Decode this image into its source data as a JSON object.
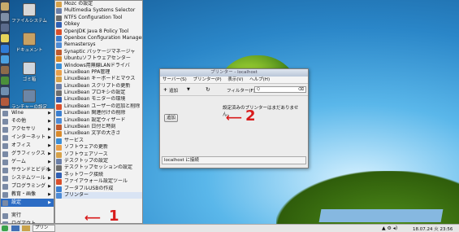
{
  "desktop": {
    "icons": [
      "ファイルシステム",
      "ドキュメント",
      "ゴミ箱",
      "ランチャーの設定"
    ]
  },
  "main_menu": {
    "items": [
      {
        "label": "Wine",
        "sub": true
      },
      {
        "label": "その他",
        "sub": true
      },
      {
        "label": "アクセサリ",
        "sub": true
      },
      {
        "label": "インターネット",
        "sub": true
      },
      {
        "label": "オフィス",
        "sub": true
      },
      {
        "label": "グラフィックス",
        "sub": true
      },
      {
        "label": "ゲーム",
        "sub": true
      },
      {
        "label": "サウンドとビデオ",
        "sub": true
      },
      {
        "label": "システムツール",
        "sub": true
      },
      {
        "label": "プログラミング",
        "sub": true
      },
      {
        "label": "教育・画像",
        "sub": true
      },
      {
        "label": "設定",
        "sub": true,
        "selected": true
      },
      {
        "label": "実行",
        "sub": false
      },
      {
        "label": "ログアウト",
        "sub": false
      }
    ]
  },
  "submenu": {
    "items": [
      "Mozc の設定",
      "Multimedia Systems Selector",
      "NTFS Configuration Tool",
      "Obkey",
      "OpenJDK Java 8 Policy Tool",
      "Openbox Configuration Manager",
      "Remastersys",
      "Synaptic パッケージマネージャ",
      "Ubuntuソフトウェアセンター",
      "Windows用無線LANドライバ",
      "LinuxBean PPA管理",
      "LinuxBean キーボードとマウス",
      "LinuxBean スクリプトの更新",
      "LinuxBean プロキシの設定",
      "LinuxBean モニターの環境",
      "LinuxBean ユーザーの追加と削除",
      "LinuxBean 関連付けの削除",
      "LinuxBean 設定ウィザード",
      "LinuxBean 日付と時刻",
      "LinuxBean 文字の大きさ",
      "サービス",
      "ソフトウェアの更新",
      "ソフトウェアソース",
      "デスクトップの設定",
      "デスクトップセッションの設定",
      "ネットワーク接続",
      "ファイアウォール設定ツール",
      "ブータブルUSBの作成",
      "プリンター"
    ]
  },
  "printer_window": {
    "title": "プリンター - localhost",
    "menus": [
      "サーバー(S)",
      "プリンター(P)",
      "表示(V)",
      "ヘルプ(H)"
    ],
    "toolbar": {
      "add": "追加",
      "filter_label": "フィルター(F):",
      "search_placeholder": "Q"
    },
    "empty_message": "設定済みのプリンターはまだありません。",
    "add_button": "追加",
    "status": "localhost に接続"
  },
  "annotations": {
    "marker1": "1",
    "marker2": "2"
  },
  "taskbar": {
    "task": "プリン",
    "time": "18.07.24 火 23:56"
  }
}
